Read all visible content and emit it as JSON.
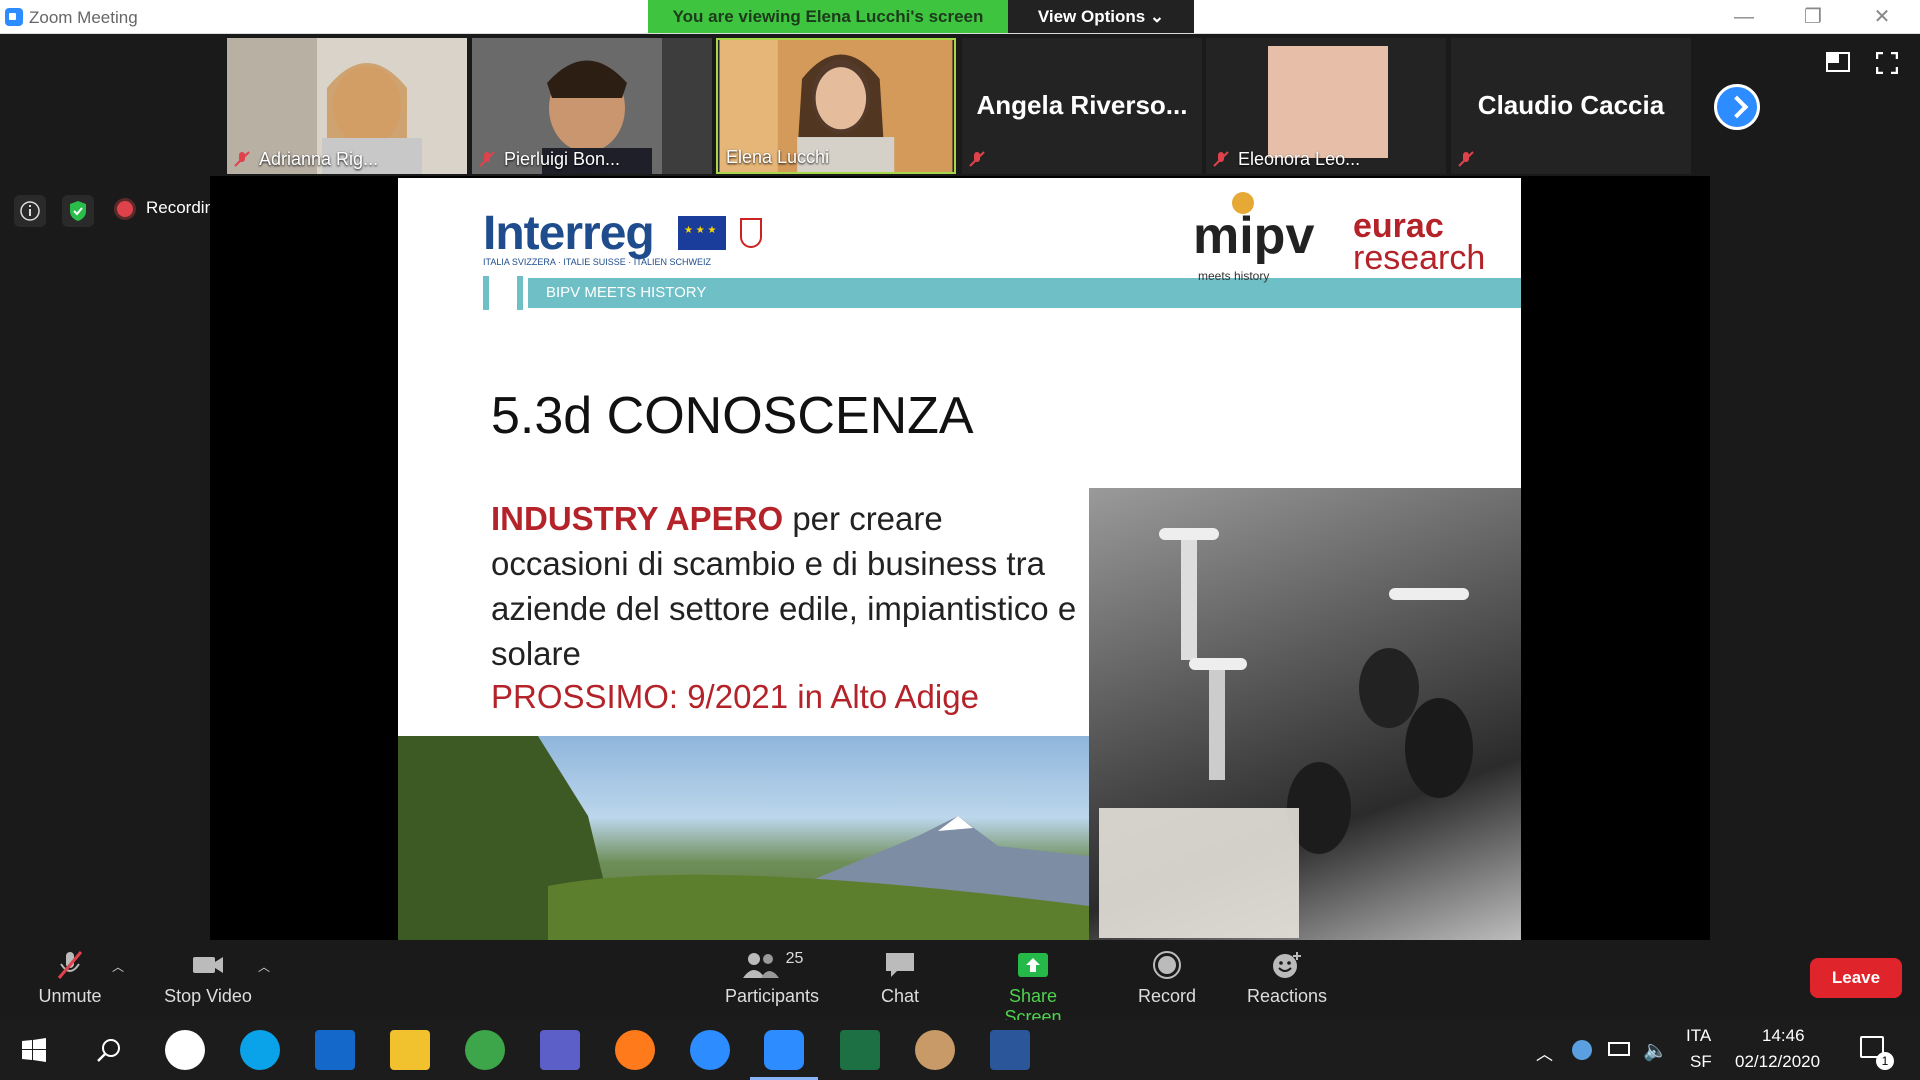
{
  "window": {
    "title": "Zoom Meeting",
    "banner": "You are viewing Elena Lucchi's screen",
    "view_options": "View Options ⌄",
    "min": "—",
    "restore": "❐",
    "close": "✕"
  },
  "participants": [
    {
      "name": "Adrianna Rig...",
      "muted": true
    },
    {
      "name": "Pierluigi Bon...",
      "muted": true
    },
    {
      "name": "Elena Lucchi",
      "muted": false
    },
    {
      "name": "Angela  Riverso...",
      "muted": true
    },
    {
      "name": "Eleonora Leo...",
      "muted": true
    },
    {
      "name": "Claudio Caccia",
      "muted": true
    }
  ],
  "status": {
    "recording": "Recording"
  },
  "slide": {
    "brand_interreg": "Interreg",
    "brand_sub": "ITALIA SVIZZERA · ITALIE SUISSE · ITALIEN SCHWEIZ",
    "band": "BIPV MEETS HISTORY",
    "mipv": "mipv",
    "mipv_sub": "meets  history",
    "eurac_1": "eurac",
    "eurac_2": "research",
    "title": "5.3d CONOSCENZA",
    "body_bold": "INDUSTRY APERO",
    "body_rest": " per creare occasioni di scambio e di business tra aziende del settore edile, impiantistico e solare",
    "next": "PROSSIMO: 9/2021 in Alto Adige"
  },
  "controls": {
    "unmute": "Unmute",
    "stop_video": "Stop Video",
    "participants": "Participants",
    "participants_count": "25",
    "chat": "Chat",
    "share_screen": "Share Screen",
    "record": "Record",
    "reactions": "Reactions",
    "leave": "Leave"
  },
  "taskbar": {
    "lang": "ITA",
    "layout": "SF",
    "time": "14:46",
    "date": "02/12/2020",
    "notif_count": "1"
  },
  "colors": {
    "zoom_blue": "#2d8cff",
    "banner_green": "#3fc43f",
    "leave_red": "#e0242b",
    "slide_red": "#b5232a"
  }
}
